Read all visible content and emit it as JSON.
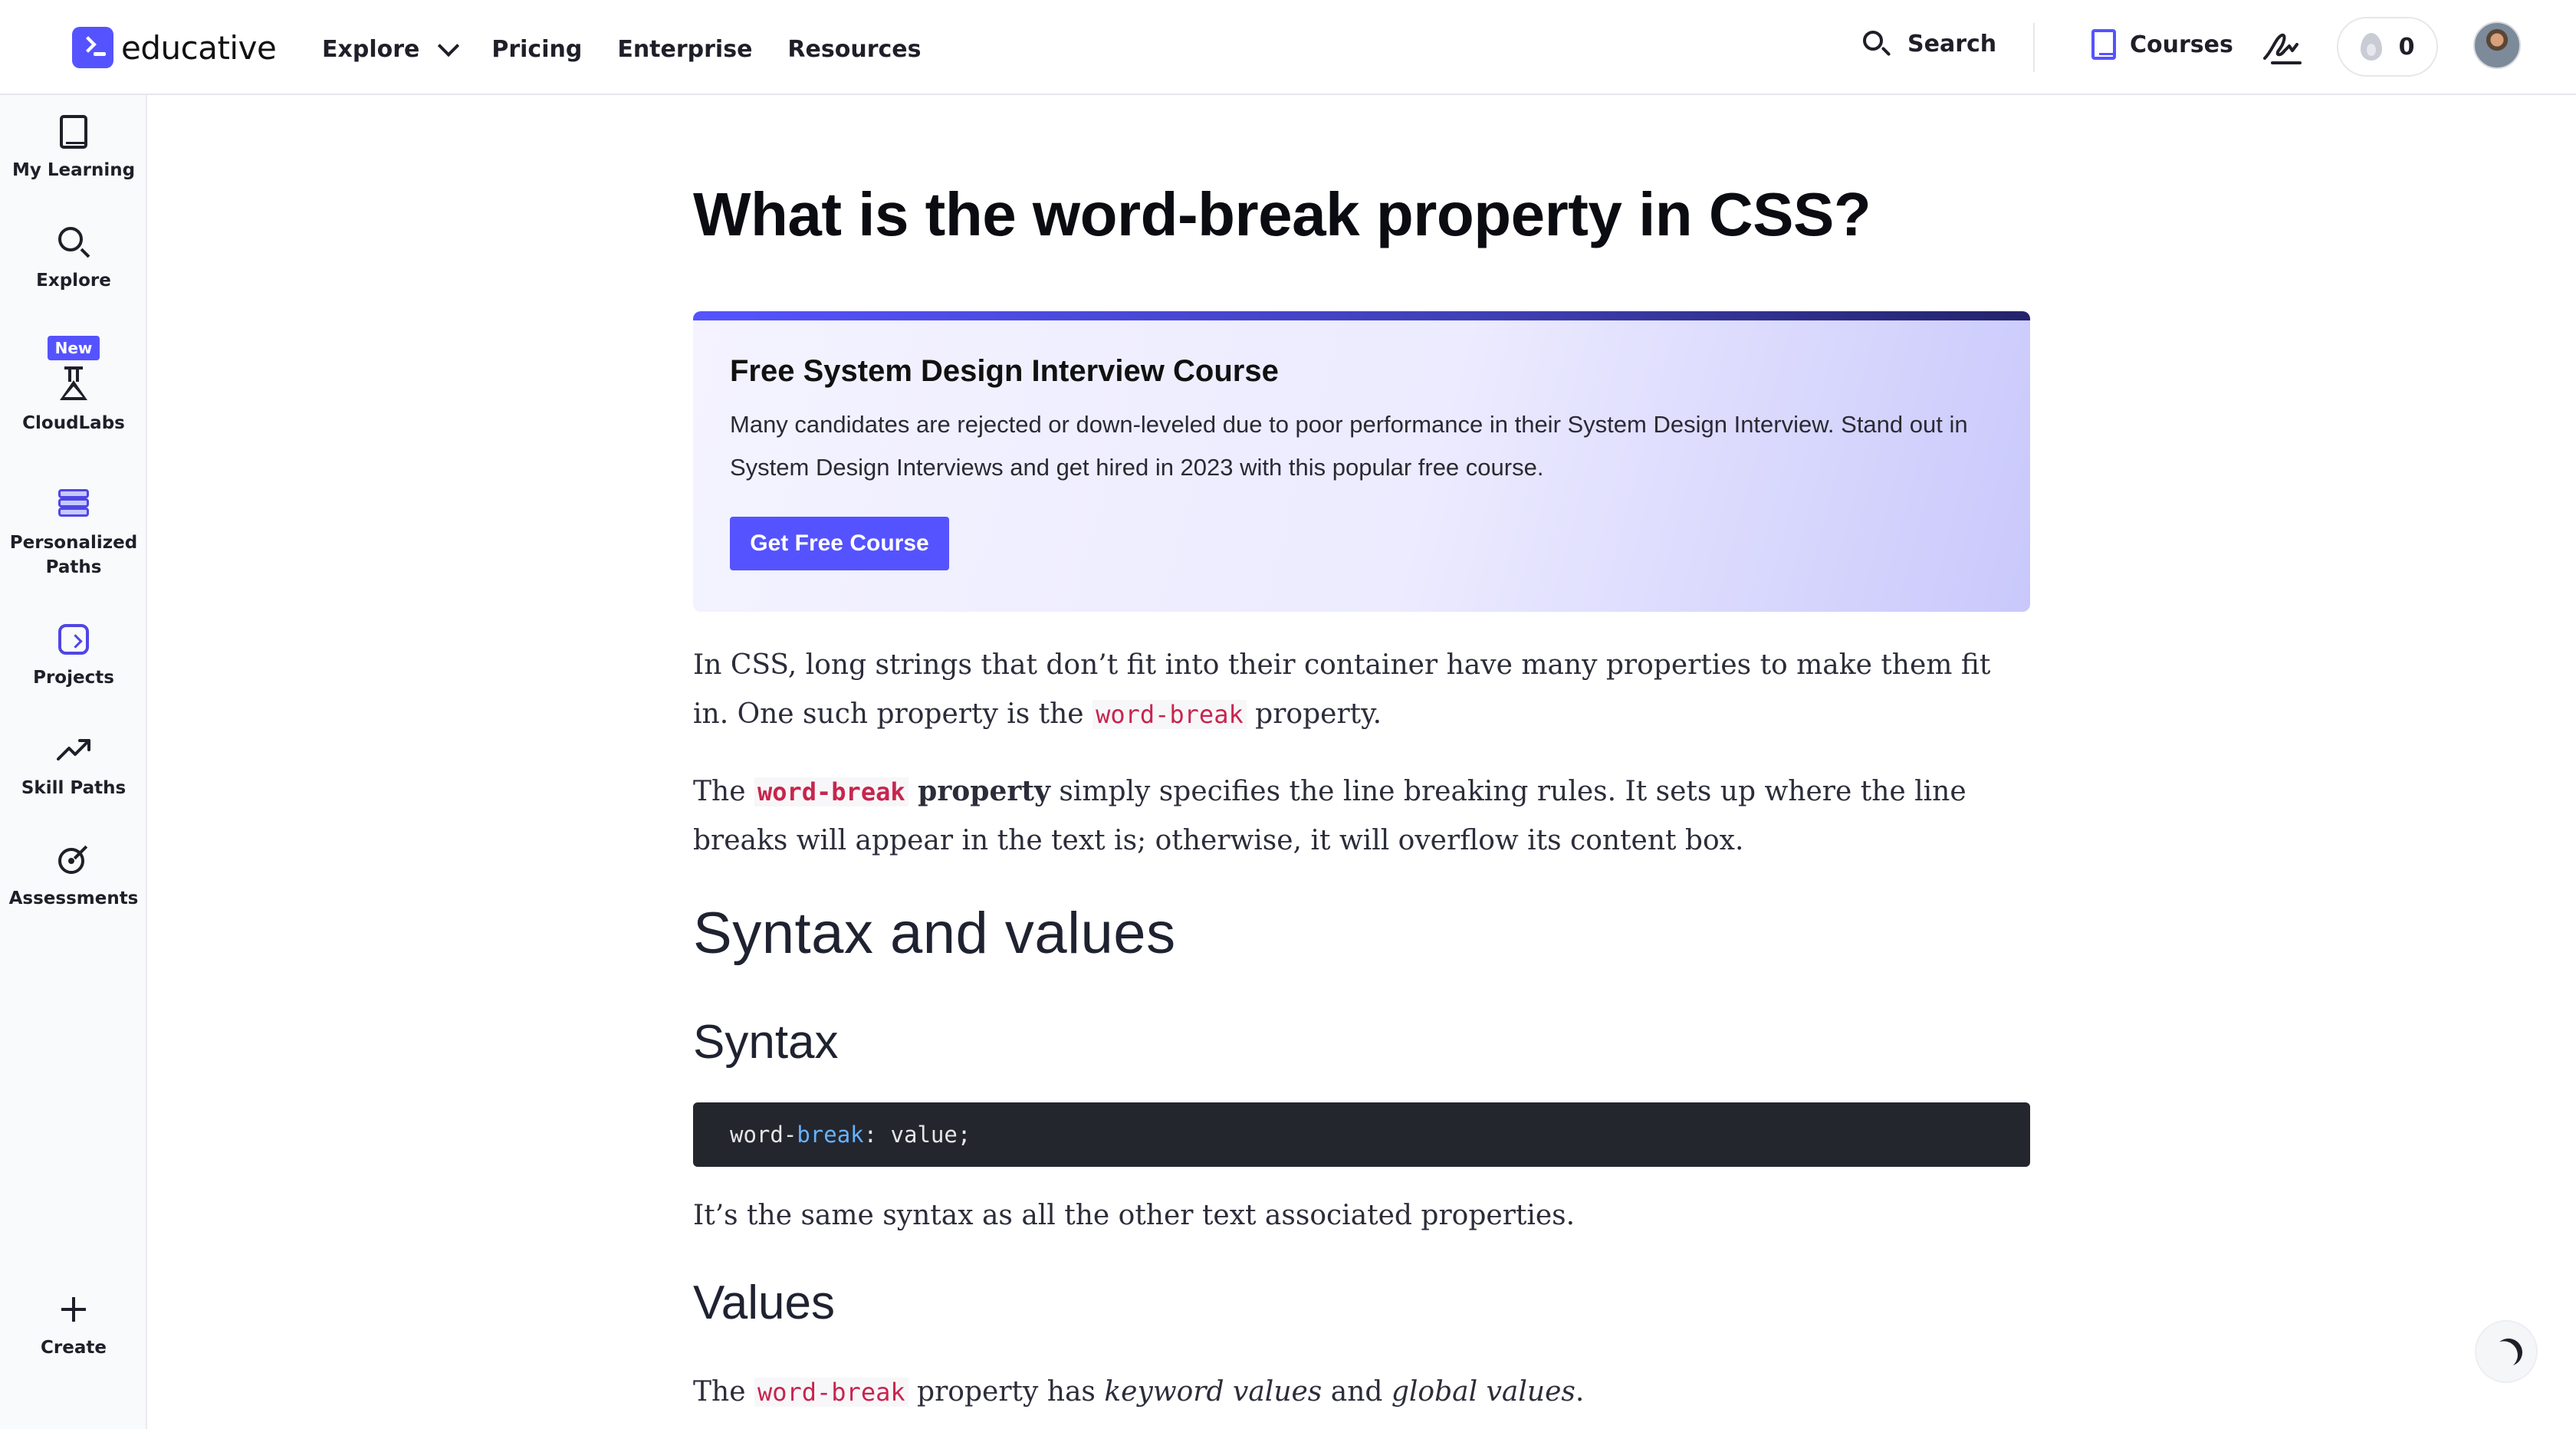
{
  "brand": {
    "name": "educative",
    "accent": "#5553ff"
  },
  "nav": {
    "links": [
      {
        "label": "Explore",
        "has_dropdown": true
      },
      {
        "label": "Pricing"
      },
      {
        "label": "Enterprise"
      },
      {
        "label": "Resources"
      }
    ],
    "search_label": "Search",
    "courses_label": "Courses",
    "streak_count": "0"
  },
  "sidebar": {
    "items": [
      {
        "label": "My Learning",
        "icon": "book-icon"
      },
      {
        "label": "Explore",
        "icon": "search-icon"
      },
      {
        "label": "CloudLabs",
        "icon": "flask-icon",
        "badge": "New"
      },
      {
        "label": "Personalized Paths",
        "icon": "layers-icon"
      },
      {
        "label": "Projects",
        "icon": "puzzle-icon"
      },
      {
        "label": "Skill Paths",
        "icon": "trending-up-icon"
      },
      {
        "label": "Assessments",
        "icon": "target-icon"
      }
    ],
    "create_label": "Create"
  },
  "article": {
    "title": "What is the word-break property in CSS?",
    "promo": {
      "title": "Free System Design Interview Course",
      "body": "Many candidates are rejected or down-leveled due to poor performance in their System Design Interview. Stand out in System Design Interviews and get hired in 2023 with this popular free course.",
      "button": "Get Free Course"
    },
    "p1_before": "In CSS, long strings that don’t fit into their container have many properties to make them fit in. One such property is the ",
    "p1_code": "word-break",
    "p1_after": " property.",
    "p2_before": "The ",
    "p2_code": "word-break",
    "p2_bold": " property",
    "p2_after": " simply specifies the line breaking rules. It sets up where the line breaks will appear in the text is; otherwise, it will overflow its content box.",
    "h2_syntax_values": "Syntax and values",
    "h3_syntax": "Syntax",
    "code": {
      "prop_start": "word-",
      "prop_kw": "break",
      "rest": ": value;"
    },
    "p3": "It’s the same syntax as all the other text associated properties.",
    "h3_values": "Values",
    "p4_before": "The ",
    "p4_code": "word-break",
    "p4_mid": " property has ",
    "p4_em1": "keyword values",
    "p4_and": " and ",
    "p4_em2": "global values",
    "p4_end": "."
  }
}
